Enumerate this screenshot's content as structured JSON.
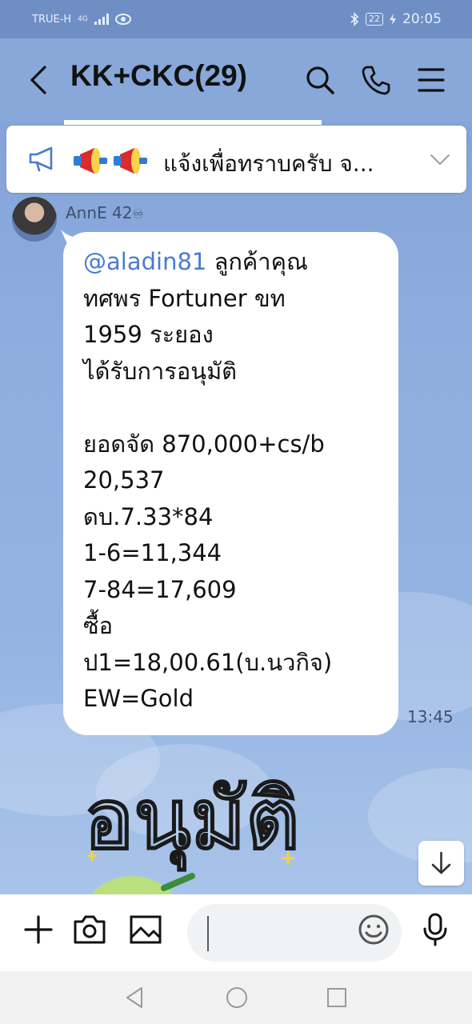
{
  "status_bar": {
    "carrier": "TRUE-H",
    "network": "4G",
    "battery": "22",
    "time": "20:05"
  },
  "header": {
    "title": "KK+CKC(29)",
    "icons": [
      "back-arrow-icon",
      "search-icon",
      "phone-icon",
      "menu-icon"
    ]
  },
  "announcement": {
    "text": "แจ้งเพื่อทราบครับ จ...",
    "icons": [
      "megaphone-icon",
      "megaphone-emoji",
      "megaphone-emoji",
      "chevron-down-icon"
    ]
  },
  "message": {
    "sender": "AnnE 42",
    "sender_suffix": "♾",
    "mention": "@aladin81",
    "lines": [
      " ลูกค้าคุณ",
      "ทศพร Fortuner ขท",
      "1959 ระยอง",
      "ได้รับการอนุมัติ",
      "",
      "ยอดจัด 870,000+cs/b",
      "20,537",
      "ดบ.7.33*84",
      "1-6=11,344",
      "7-84=17,609",
      "ซื้อ",
      "ป1=18,00.61(บ.นวกิจ)",
      "EW=Gold"
    ],
    "time": "13:45"
  },
  "sticker": {
    "text": "อนุมัติ"
  },
  "input_bar": {
    "placeholder": "",
    "icons": [
      "plus-icon",
      "camera-icon",
      "image-icon",
      "emoji-icon",
      "microphone-icon"
    ]
  },
  "nav_bar": {
    "icons": [
      "nav-back-icon",
      "nav-home-icon",
      "nav-recents-icon"
    ]
  },
  "colors": {
    "chat_background": "#87a8d9",
    "mention": "#4a7bd0",
    "bubble": "#ffffff"
  }
}
